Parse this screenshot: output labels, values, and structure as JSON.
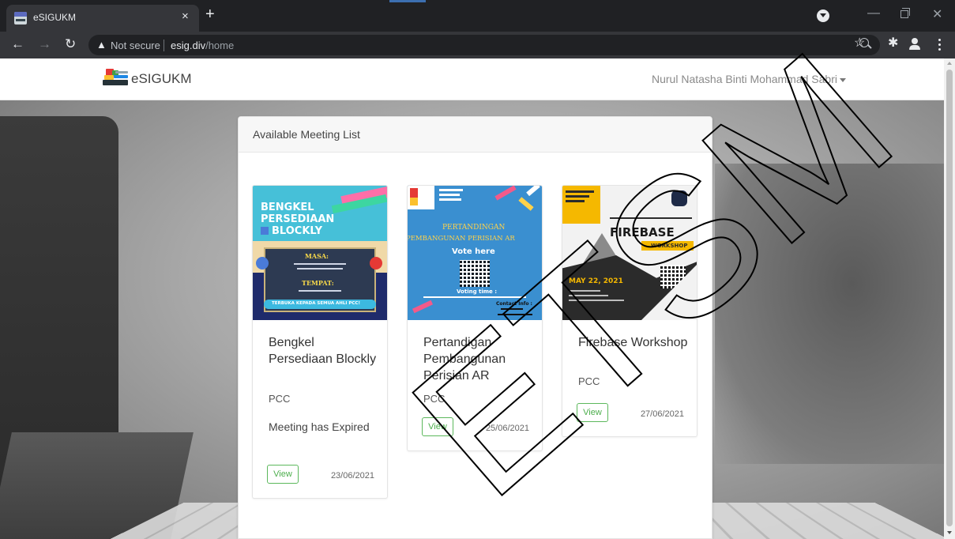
{
  "browser": {
    "tab_title": "eSIGUKM",
    "close_glyph": "×",
    "new_tab_glyph": "+",
    "security_label": "Not secure",
    "url_host": "esig.div",
    "url_path": "/home"
  },
  "navbar": {
    "brand": "eSIGUKM",
    "user_name": "Nurul Natasha Binti Mohammad Sabri"
  },
  "panel": {
    "title": "Available Meeting List"
  },
  "meetings": [
    {
      "title": "Bengkel Persediaan Blockly",
      "organizer": "PCC",
      "status": "Meeting has Expired",
      "view_label": "View",
      "date": "23/06/2021",
      "poster": {
        "line1": "BENGKEL",
        "line2": "PERSEDIAAN",
        "line3": "BLOCKLY",
        "masa": "MASA:",
        "tempat": "TEMPAT:",
        "footer": "TERBUKA KEPADA SEMUA AHLI PCC!",
        "colors": {
          "bg": "#46c0d8",
          "band": "#1f2b6b",
          "sand": "#f0d9a8",
          "accent": "#f7d84a"
        }
      }
    },
    {
      "title": "Pertandigan Pembangunan Perisian AR",
      "organizer": "PCC",
      "status": "",
      "view_label": "View",
      "date": "25/06/2021",
      "poster": {
        "line1": "PERTANDINGAN",
        "line2": "PEMBANGUNAN PERISIAN AR",
        "line3": "Vote here",
        "voting": "Voting time :",
        "contact": "Contact Info :",
        "colors": {
          "bg": "#3a8fd0",
          "accent": "#f25a8a",
          "text": "#ffd24a"
        }
      }
    },
    {
      "title": "Firebase Workshop",
      "organizer": "PCC",
      "status": "",
      "view_label": "View",
      "date": "27/06/2021",
      "poster": {
        "line1": "FIREBASE",
        "line2": "WORKSHOP",
        "line3": "MAY 22, 2021",
        "colors": {
          "bg": "#f2f2f2",
          "yellow": "#f5b800",
          "dark": "#2b2b2b"
        }
      }
    }
  ],
  "watermark": {
    "text": "ETSM",
    "color": "#000000"
  }
}
